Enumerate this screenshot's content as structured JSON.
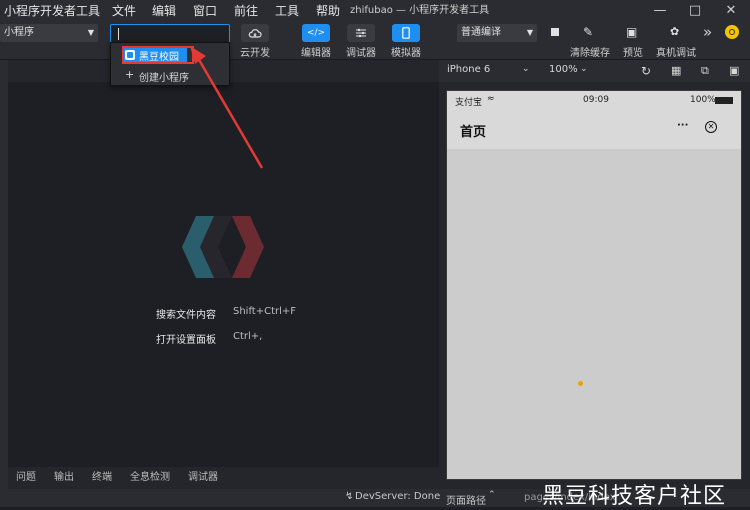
{
  "titlebar": {
    "app_name": "小程序开发者工具",
    "menus": [
      "文件",
      "编辑",
      "窗口",
      "前往",
      "工具",
      "帮助"
    ],
    "window_title": "zhifubao — 小程序开发者工具"
  },
  "toolbar": {
    "project_select": "小程序",
    "search_value": "",
    "cloud_label": "云开发",
    "editor_label": "编辑器",
    "debugger_label": "调试器",
    "simulator_label": "模拟器",
    "compile_select": "普通编译",
    "clear_cache_label": "清除缓存",
    "preview_label": "预览",
    "real_debug_label": "真机调试",
    "more_symbol": "»"
  },
  "dropdown": {
    "items": [
      {
        "label": "黑豆校园"
      },
      {
        "label": "创建小程序",
        "prefix": "+"
      }
    ]
  },
  "editor": {
    "hints": [
      {
        "label": "搜索文件内容",
        "shortcut": "Shift+Ctrl+F"
      },
      {
        "label": "打开设置面板",
        "shortcut": "Ctrl+,"
      }
    ]
  },
  "panel_tabs": [
    "问题",
    "输出",
    "终端",
    "全息检测",
    "调试器"
  ],
  "simulator": {
    "device": "iPhone 6",
    "zoom": "100%",
    "status_carrier": "支付宝",
    "status_time": "09:09",
    "status_battery": "100%",
    "page_title": "首页",
    "more_symbol": "···"
  },
  "statusbar": {
    "devserver": "DevServer: Done",
    "page_path_label": "页面路径",
    "page_path_value": "pages/index/index"
  },
  "watermark": "黑豆科技客户社区",
  "colors": {
    "accent_blue": "#1e8ef0",
    "highlight_red": "#e53935",
    "logo_teal": "#2d6a7a",
    "logo_red": "#7a2e34"
  }
}
